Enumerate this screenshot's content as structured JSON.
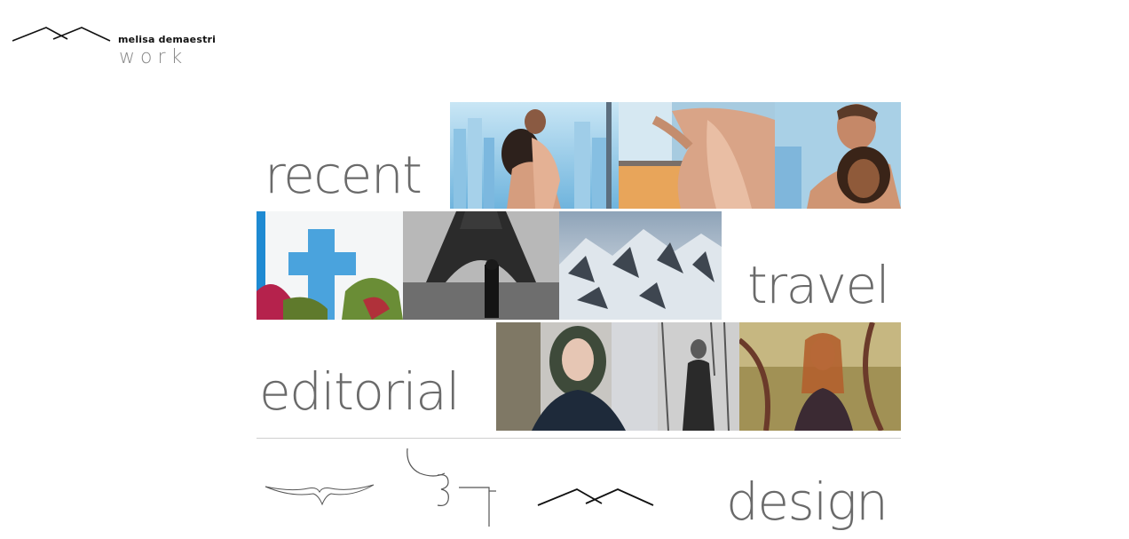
{
  "header": {
    "brand_name": "melisa demaestri",
    "brand_sub": "work",
    "logo_icon": "mountain-peaks-icon"
  },
  "sections": {
    "recent": {
      "label": "recent"
    },
    "travel": {
      "label": "travel"
    },
    "editorial": {
      "label": "editorial"
    },
    "design": {
      "label": "design"
    }
  },
  "colors": {
    "label_gray": "#6a6a6a",
    "sub_gray": "#8a8a8a",
    "divider": "#cfcfcf"
  }
}
